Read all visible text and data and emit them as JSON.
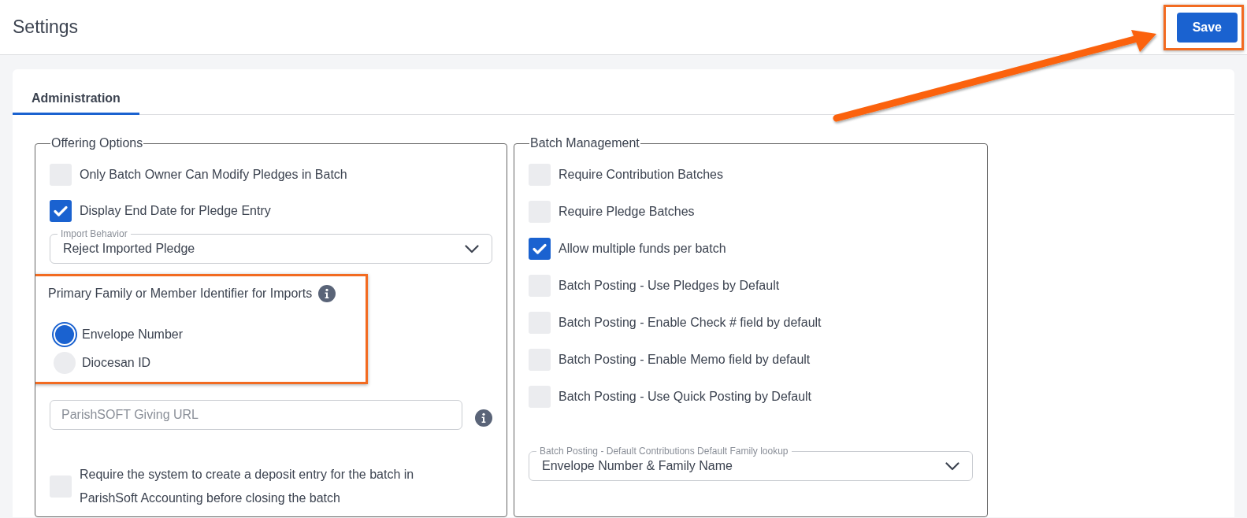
{
  "header": {
    "title": "Settings",
    "save_button": "Save"
  },
  "tabs": [
    {
      "label": "Administration",
      "selected": true
    }
  ],
  "offering_options": {
    "legend": "Offering Options",
    "checkboxes": [
      {
        "label": "Only Batch Owner Can Modify Pledges in Batch",
        "checked": false
      },
      {
        "label": "Display End Date for Pledge Entry",
        "checked": true
      }
    ],
    "import_behavior": {
      "label": "Import Behavior",
      "value": "Reject Imported Pledge"
    },
    "identifier": {
      "label": "Primary Family or Member Identifier for Imports",
      "options": [
        {
          "label": "Envelope Number",
          "selected": true
        },
        {
          "label": "Diocesan ID",
          "selected": false
        }
      ]
    },
    "giving_url": {
      "placeholder": "ParishSOFT Giving URL"
    },
    "deposit_checkbox": {
      "label": "Require the system to create a deposit entry for the batch in ParishSoft Accounting before closing the batch",
      "checked": false
    }
  },
  "batch_management": {
    "legend": "Batch Management",
    "checkboxes": [
      {
        "label": "Require Contribution Batches",
        "checked": false
      },
      {
        "label": "Require Pledge Batches",
        "checked": false
      },
      {
        "label": "Allow multiple funds per batch",
        "checked": true
      },
      {
        "label": "Batch Posting - Use Pledges by Default",
        "checked": false
      },
      {
        "label": "Batch Posting - Enable Check # field by default",
        "checked": false
      },
      {
        "label": "Batch Posting - Enable Memo field by default",
        "checked": false
      },
      {
        "label": "Batch Posting - Use Quick Posting by Default",
        "checked": false
      }
    ],
    "default_lookup": {
      "label": "Batch Posting - Default Contributions Default Family lookup",
      "value": "Envelope Number & Family Name"
    }
  }
}
